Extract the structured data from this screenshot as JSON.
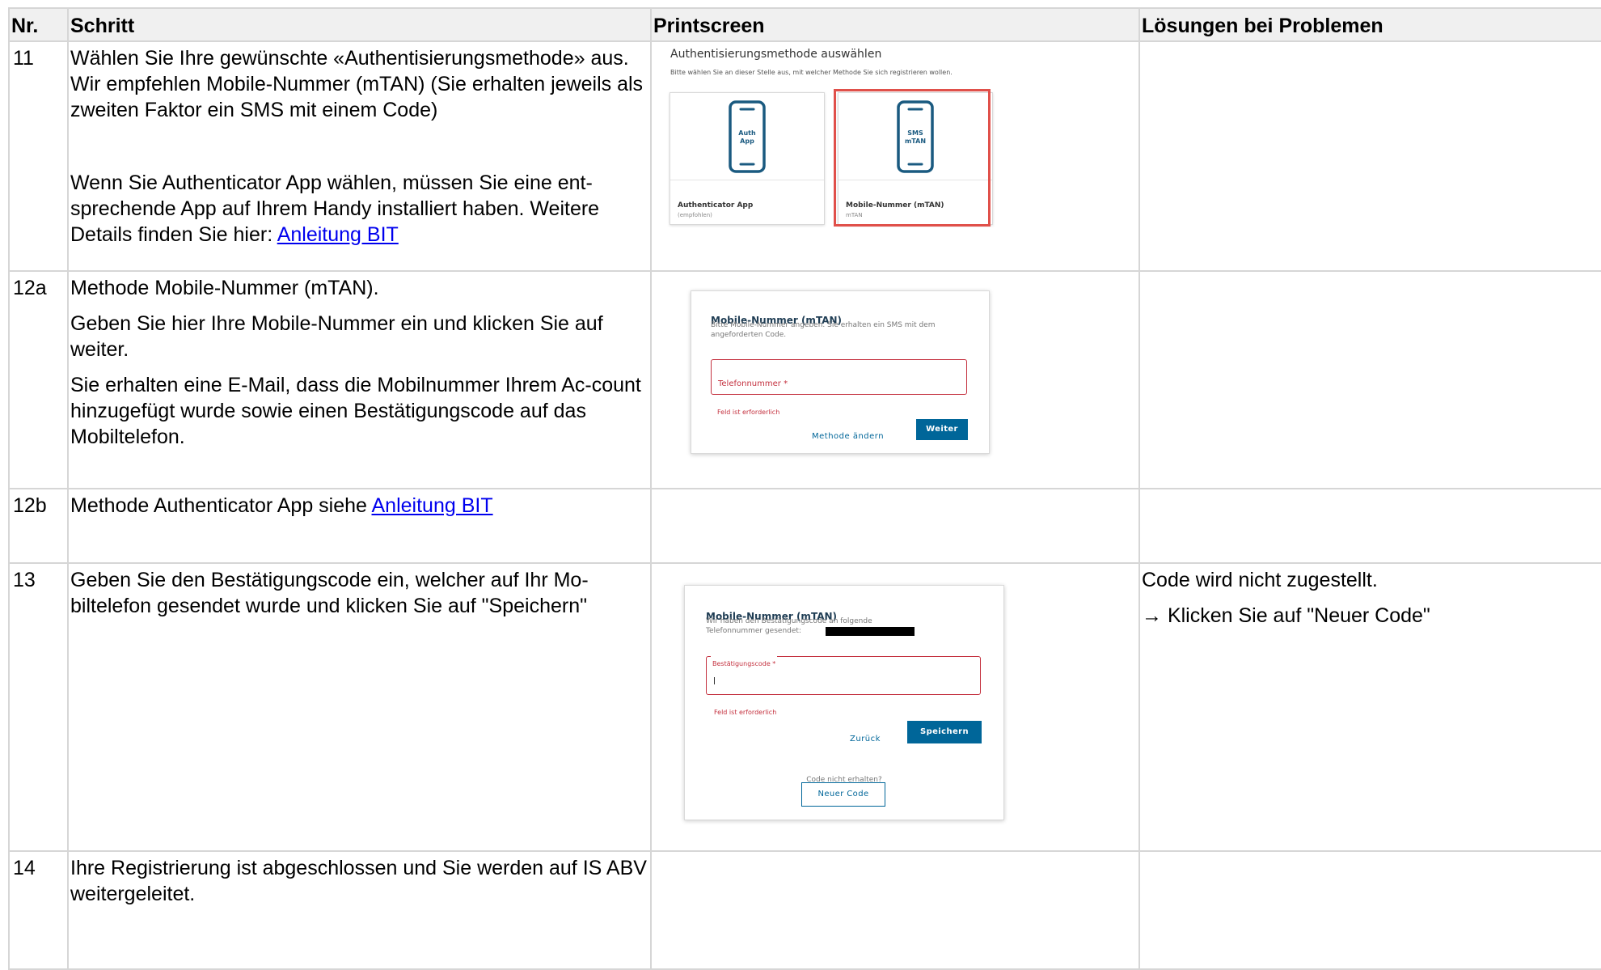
{
  "table": {
    "headers": [
      "Nr.",
      "Schritt",
      "Printscreen",
      "Lösungen bei Problemen"
    ],
    "rows": {
      "r11": {
        "nr": "11",
        "para1": "Wählen Sie Ihre gewünschte «Authentisierungsmethode» aus. Wir empfehlen Mobile-Nummer (mTAN) (Sie erhalten jeweils als zweiten Faktor ein SMS mit einem Code)",
        "para2_text": "Wenn Sie Authenticator App wählen, müssen Sie eine ent-sprechende App auf Ihrem Handy installiert haben. Weitere Details finden Sie hier: ",
        "para2_link": "Anleitung BIT"
      },
      "r12a": {
        "nr": "12a",
        "para1": "Methode Mobile-Nummer (mTAN).",
        "para2": "Geben Sie hier Ihre Mobile-Nummer ein und klicken Sie auf weiter.",
        "para3": "Sie erhalten eine E-Mail, dass die Mobilnummer Ihrem Ac-count hinzugefügt wurde sowie einen Bestätigungscode auf das Mobiltelefon."
      },
      "r12b": {
        "nr": "12b",
        "text": "Methode Authenticator App siehe ",
        "link": "Anleitung BIT"
      },
      "r13": {
        "nr": "13",
        "text": "Geben Sie den Bestätigungscode ein, welcher auf Ihr Mo-biltelefon gesendet wurde und klicken Sie auf \"Speichern\"",
        "solution1": "Code wird nicht zugestellt.",
        "solution2": "→ Klicken Sie auf \"Neuer Code\""
      },
      "r14": {
        "nr": "14",
        "text": "Ihre Registrierung ist abgeschlossen und Sie werden auf IS ABV weitergeleitet."
      }
    }
  },
  "screens": {
    "auth_select": {
      "title": "Authentisierungsmethode auswählen",
      "subtitle": "Bitte wählen Sie an dieser Stelle aus, mit welcher Methode Sie sich registrieren wollen.",
      "cards": [
        {
          "phone_text": [
            "Auth",
            "App"
          ],
          "label": "Authenticator App",
          "sublabel": "(empfohlen)"
        },
        {
          "phone_text": [
            "SMS",
            "mTAN"
          ],
          "label": "Mobile-Nummer (mTAN)",
          "sublabel": "mTAN"
        }
      ],
      "highlight_color": "#e0504a"
    },
    "mtan_phone": {
      "title": "Mobile-Nummer (mTAN)",
      "desc": "Bitte Mobile-Nummer angeben. Sie erhalten ein SMS mit dem angeforderten Code.",
      "field_label": "Telefonnummer *",
      "error": "Feld ist erforderlich",
      "secondary": "Methode ändern",
      "primary": "Weiter"
    },
    "mtan_code": {
      "title": "Mobile-Nummer (mTAN)",
      "desc_line1": "Wir haben den Bestätigungscode an folgende",
      "desc_line2": "Telefonnummer gesendet:",
      "field_label": "Bestätigungscode *",
      "error": "Feld ist erforderlich",
      "secondary": "Zurück",
      "primary": "Speichern",
      "note": "Code nicht erhalten?",
      "resend": "Neuer Code"
    }
  },
  "colors": {
    "accent": "#006699",
    "error": "#c4313f",
    "link": "#0000ee",
    "phone_icon": "#1a5a80"
  }
}
